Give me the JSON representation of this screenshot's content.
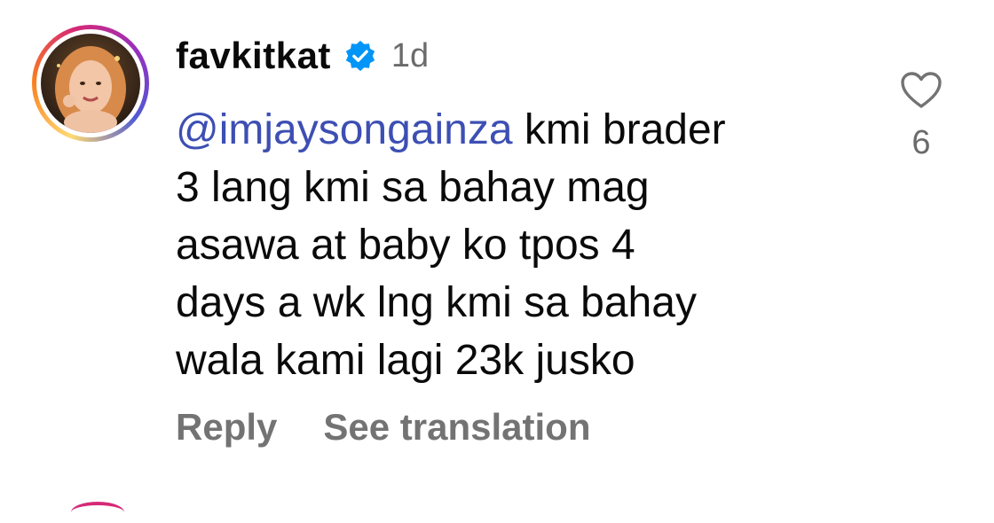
{
  "comment": {
    "username": "favkitkat",
    "time": "1d",
    "mention": "@imjaysongainza",
    "text_lines": [
      " kmi brader",
      "3 lang kmi sa bahay mag",
      "asawa at baby ko tpos 4",
      "days a wk lng kmi sa bahay",
      "wala kami lagi 23k jusko"
    ],
    "actions": {
      "reply": "Reply",
      "translate": "See translation"
    },
    "likes": "6"
  },
  "colors": {
    "verified": "#0095f6",
    "mention": "#3d4fb3",
    "muted": "#737373"
  },
  "icons": {
    "verified": "verified-badge-icon",
    "like": "heart-outline-icon"
  }
}
